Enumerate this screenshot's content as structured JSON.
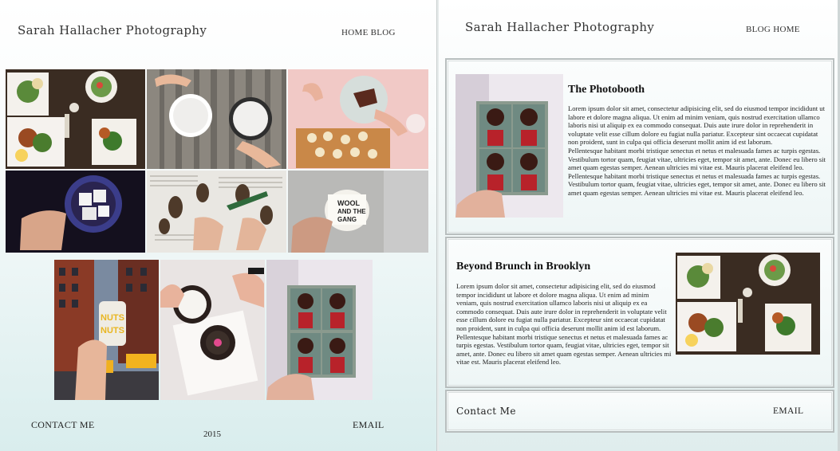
{
  "left": {
    "brand": "Sarah Hallacher Photography",
    "nav": [
      "Home",
      "Blog"
    ],
    "contact": "CONTACT ME",
    "email": "EMAIL",
    "year": "2015"
  },
  "right": {
    "brand": "Sarah Hallacher Photography",
    "nav": [
      "Blog",
      "Home"
    ],
    "post1": {
      "title": "The Photobooth",
      "p1": "Lorem ipsum dolor sit amet, consectetur adipisicing elit, sed do eiusmod tempor incididunt ut labore et dolore magna aliqua. Ut enim ad minim veniam, quis nostrud exercitation ullamco laboris nisi ut aliquip ex ea commodo consequat. Duis aute irure dolor in reprehenderit in voluptate velit esse cillum dolore eu fugiat nulla pariatur. Excepteur sint occaecat cupidatat non proident, sunt in culpa qui officia deserunt mollit anim id est laborum.",
      "p2": "Pellentesque habitant morbi tristique senectus et netus et malesuada fames ac turpis egestas. Vestibulum tortor quam, feugiat vitae, ultricies eget, tempor sit amet, ante. Donec eu libero sit amet quam egestas semper. Aenean ultricies mi vitae est. Mauris placerat eleifend leo.",
      "p3": "Pellentesque habitant morbi tristique senectus et netus et malesuada fames ac turpis egestas. Vestibulum tortor quam, feugiat vitae, ultricies eget, tempor sit amet, ante. Donec eu libero sit amet quam egestas semper. Aenean ultricies mi vitae est. Mauris placerat eleifend leo."
    },
    "post2": {
      "title": "Beyond Brunch in Brooklyn",
      "p1": "Lorem ipsum dolor sit amet, consectetur adipisicing elit, sed do eiusmod tempor incididunt ut labore et dolore magna aliqua. Ut enim ad minim veniam, quis nostrud exercitation ullamco laboris nisi ut aliquip ex ea commodo consequat. Duis aute irure dolor in reprehenderit in voluptate velit esse cillum dolore eu fugiat nulla pariatur. Excepteur sint occaecat cupidatat non proident, sunt in culpa qui officia deserunt mollit anim id est laborum.",
      "p2": "Pellentesque habitant morbi tristique senectus et netus et malesuada fames ac turpis egestas. Vestibulum tortor quam, feugiat vitae, ultricies eget, tempor sit amet, ante. Donec eu libero sit amet quam egestas semper. Aenean ultricies mi vitae est. Mauris placerat eleifend leo."
    },
    "contact": "Contact Me",
    "email": "EMAIL"
  },
  "photos": {
    "wool_text_1": "WOOL",
    "wool_text_2": "AND THE",
    "wool_text_3": "GANG",
    "nuts_text": "NUTS"
  }
}
